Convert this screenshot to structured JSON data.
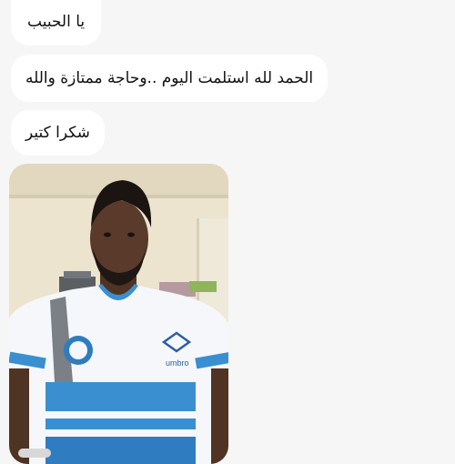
{
  "messages": [
    {
      "text": "يا الحبيب"
    },
    {
      "text": "الحمد لله استلمت اليوم ..وحاجة ممتازة والله"
    },
    {
      "text": "شكرا كتير"
    }
  ],
  "photo": {
    "shirt_brand": "umbro",
    "colors": {
      "wall": "#ece4cf",
      "shirt_blue": "#3a8fd0",
      "shirt_white": "#f5f7fa",
      "skin": "#5a3a2a"
    }
  }
}
